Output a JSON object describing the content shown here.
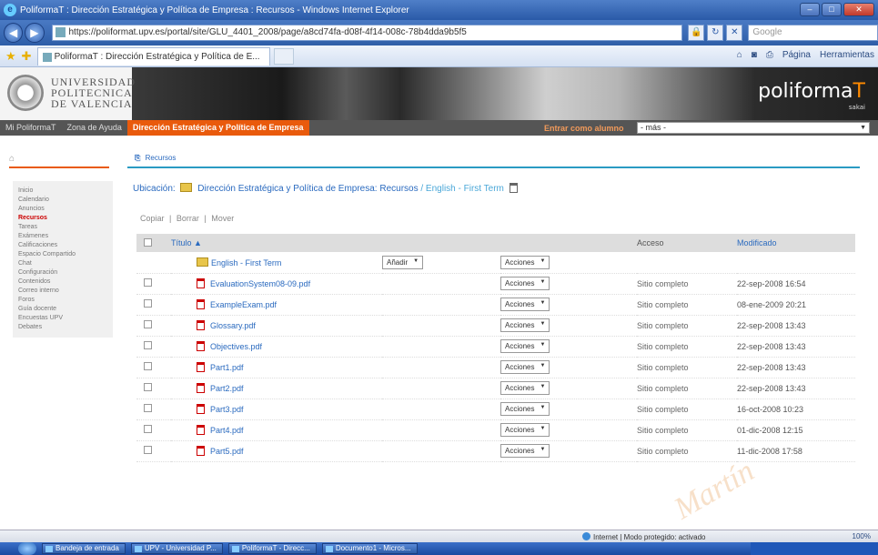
{
  "window": {
    "title": "PoliformaT : Dirección Estratégica y Política de Empresa : Recursos - Windows Internet Explorer"
  },
  "addressbar": {
    "url": "https://poliformat.upv.es/portal/site/GLU_4401_2008/page/a8cd74fa-d08f-4f14-008c-78b4dda9b5f5",
    "search_placeholder": "Google"
  },
  "tabs": [
    {
      "label": "PoliformaT : Dirección Estratégica y Política de E..."
    }
  ],
  "commandbar": {
    "page_label": "Página",
    "tools_label": "Herramientas"
  },
  "header": {
    "university_line1": "UNIVERSIDAD",
    "university_line2": "POLITECNICA",
    "university_line3": "DE VALENCIA",
    "brand_main": "poliforma",
    "brand_accent": "T",
    "brand_sub": "sakai"
  },
  "sitenav": {
    "items": [
      {
        "label": "Mi PoliformaT",
        "active": false
      },
      {
        "label": "Zona de Ayuda",
        "active": false
      },
      {
        "label": "Dirección Estratégica y Política de Empresa",
        "active": true
      }
    ],
    "more_label": "Entrar como alumno",
    "site_select_value": "- más -"
  },
  "leftmenu": {
    "items": [
      {
        "label": "Inicio",
        "selected": false
      },
      {
        "label": "Calendario",
        "selected": false
      },
      {
        "label": "Anuncios",
        "selected": false
      },
      {
        "label": "Recursos",
        "selected": true
      },
      {
        "label": "Tareas",
        "selected": false
      },
      {
        "label": "Exámenes",
        "selected": false
      },
      {
        "label": "Calificaciones",
        "selected": false
      },
      {
        "label": "Espacio Compartido",
        "selected": false
      },
      {
        "label": "Chat",
        "selected": false
      },
      {
        "label": "Configuración",
        "selected": false
      },
      {
        "label": "Contenidos",
        "selected": false
      },
      {
        "label": "Correo interno",
        "selected": false
      },
      {
        "label": "Foros",
        "selected": false
      },
      {
        "label": "Guía docente",
        "selected": false
      },
      {
        "label": "Encuestas UPV",
        "selected": false
      },
      {
        "label": "Debates",
        "selected": false
      }
    ]
  },
  "main": {
    "crumb_title": "Recursos",
    "location_label": "Ubicación:",
    "location_path": "Dirección Estratégica y Política de Empresa: Recursos",
    "location_sub": " / English - First Term",
    "actions": [
      "Copiar",
      "Borrar",
      "Mover"
    ],
    "table": {
      "col_title": "Título",
      "sort_indicator": "▲",
      "col_access": "Acceso",
      "col_modified": "Modificado",
      "folder": {
        "name": "English - First Term",
        "add_label": "Añadir",
        "actions_label": "Acciones"
      },
      "rows": [
        {
          "name": "EvaluationSystem08-09.pdf",
          "actions_label": "Acciones",
          "access": "Sitio completo",
          "modified": "22-sep-2008 16:54"
        },
        {
          "name": "ExampleExam.pdf",
          "actions_label": "Acciones",
          "access": "Sitio completo",
          "modified": "08-ene-2009 20:21"
        },
        {
          "name": "Glossary.pdf",
          "actions_label": "Acciones",
          "access": "Sitio completo",
          "modified": "22-sep-2008 13:43"
        },
        {
          "name": "Objectives.pdf",
          "actions_label": "Acciones",
          "access": "Sitio completo",
          "modified": "22-sep-2008 13:43"
        },
        {
          "name": "Part1.pdf",
          "actions_label": "Acciones",
          "access": "Sitio completo",
          "modified": "22-sep-2008 13:43"
        },
        {
          "name": "Part2.pdf",
          "actions_label": "Acciones",
          "access": "Sitio completo",
          "modified": "22-sep-2008 13:43"
        },
        {
          "name": "Part3.pdf",
          "actions_label": "Acciones",
          "access": "Sitio completo",
          "modified": "16-oct-2008 10:23"
        },
        {
          "name": "Part4.pdf",
          "actions_label": "Acciones",
          "access": "Sitio completo",
          "modified": "01-dic-2008 12:15"
        },
        {
          "name": "Part5.pdf",
          "actions_label": "Acciones",
          "access": "Sitio completo",
          "modified": "11-dic-2008 17:58"
        }
      ]
    }
  },
  "statusbar": {
    "zone": "Internet | Modo protegido: activado",
    "zoom": "100%"
  },
  "taskbar": {
    "tasks": [
      "Bandeja de entrada",
      "UPV - Universidad P...",
      "PoliformaT - Direcc...",
      "Documento1 - Micros..."
    ]
  },
  "watermark": "Martín"
}
